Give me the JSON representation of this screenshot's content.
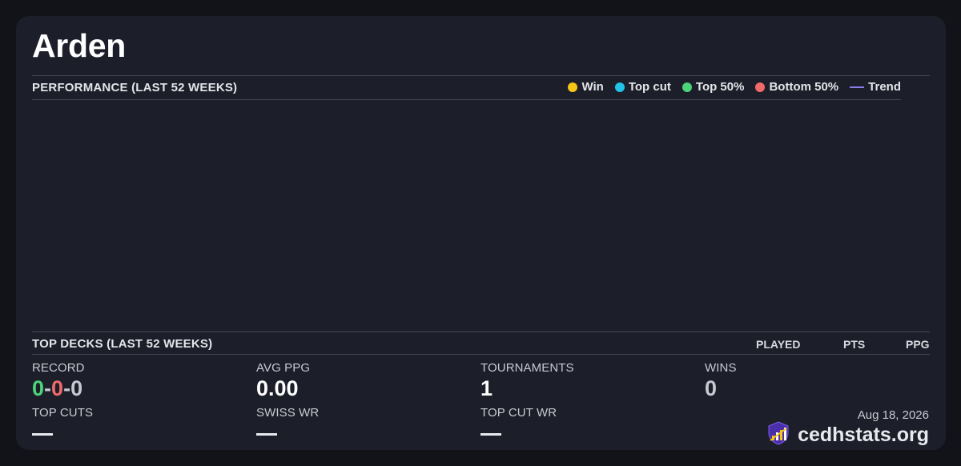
{
  "player": {
    "name": "Arden"
  },
  "performance": {
    "title": "PERFORMANCE (LAST 52 WEEKS)",
    "legend": [
      {
        "label": "Win",
        "color": "#f5c518",
        "shape": "dot"
      },
      {
        "label": "Top cut",
        "color": "#22c4e8",
        "shape": "dot"
      },
      {
        "label": "Top 50%",
        "color": "#4cd47a",
        "shape": "dot"
      },
      {
        "label": "Bottom 50%",
        "color": "#f06a6a",
        "shape": "dot"
      },
      {
        "label": "Trend",
        "color": "#8a7df0",
        "shape": "line"
      }
    ]
  },
  "top_decks": {
    "title": "TOP DECKS (LAST 52 WEEKS)",
    "columns": [
      "PLAYED",
      "PTS",
      "PPG"
    ]
  },
  "stats": {
    "record": {
      "label": "RECORD",
      "wins": "0",
      "losses": "0",
      "draws": "0",
      "sep": "-"
    },
    "avg_ppg": {
      "label": "AVG PPG",
      "value": "0.00"
    },
    "tournaments": {
      "label": "TOURNAMENTS",
      "value": "1"
    },
    "wins": {
      "label": "WINS",
      "value": "0"
    },
    "top_cuts": {
      "label": "TOP CUTS"
    },
    "swiss_wr": {
      "label": "SWISS WR"
    },
    "top_cut_wr": {
      "label": "TOP CUT WR"
    }
  },
  "footer": {
    "date": "Aug 18, 2026",
    "brand": "cedhstats.org",
    "logo_icon": "shield-chart-logo"
  },
  "colors": {
    "background": "#111318",
    "card": "#1c1e29",
    "win_green": "#4cd47a",
    "loss_red": "#f06a6a",
    "draw_gray": "#c7c9d2",
    "wins_muted": "#c7c9d2",
    "logo_purple": "#4b2fa8",
    "logo_gold": "#f5c518"
  }
}
